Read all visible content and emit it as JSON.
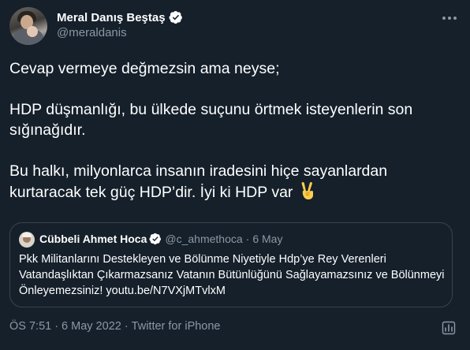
{
  "author": {
    "display_name": "Meral Danış Beştaş",
    "handle": "@meraldanis",
    "verified": true
  },
  "tweet": {
    "text": "Cevap vermeye değmezsin ama neyse;\n\nHDP düşmanlığı, bu ülkede suçunu örtmek isteyenlerin son sığınağıdır.\n\nBu halkı, milyonlarca insanın iradesini hiçe sayanlardan kurtaracak tek güç HDP’dir. İyi ki HDP var",
    "emoji": "victory-hand"
  },
  "quoted_tweet": {
    "display_name": "Cübbeli Ahmet Hoca",
    "handle": "@c_ahmethoca",
    "separator": "·",
    "date": "6 May",
    "verified": true,
    "text": "Pkk Militanlarını Destekleyen ve Bölünme Niyetiyle Hdp’ye Rey Verenleri Vatandaşlıktan Çıkarmazsanız Vatanın Bütünlüğünü Sağlayamazsınız ve Bölünmeyi Önleyemezsiniz! youtu.be/N7VXjMTvlxM"
  },
  "meta": {
    "time": "ÖS 7:51",
    "sep1": "·",
    "date": "6 May 2022",
    "sep2": "·",
    "source": "Twitter for iPhone"
  },
  "colors": {
    "background": "#15202b",
    "text": "#ffffff",
    "secondary": "#8b98a5",
    "border": "#38444d",
    "verified": "#ffffff"
  }
}
